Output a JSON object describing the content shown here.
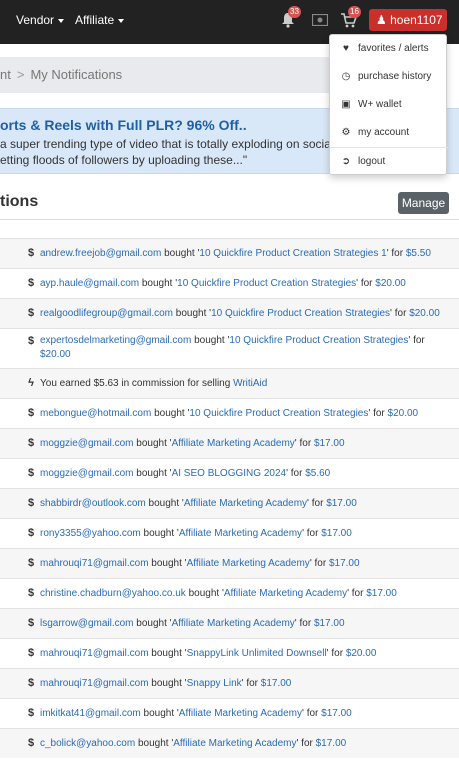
{
  "navbar": {
    "vendor_label": "Vendor",
    "affiliate_label": "Affiliate",
    "notifications_count": "33",
    "cart_count": "16",
    "username": "hoen1107"
  },
  "dropdown": {
    "items": [
      {
        "label": "favorites / alerts",
        "icon": "heart-icon"
      },
      {
        "label": "purchase history",
        "icon": "history-icon"
      },
      {
        "label": "W+ wallet",
        "icon": "wallet-icon"
      },
      {
        "label": "my account",
        "icon": "gear-icon"
      },
      {
        "label": "logout",
        "icon": "logout-icon"
      }
    ]
  },
  "breadcrumb": {
    "parent": "nt",
    "current": "My Notifications"
  },
  "promo": {
    "title": "orts & Reels with Full PLR? 96% Off..",
    "line1": "a super trending type of video that is totally exploding on socia",
    "line2": "etting floods of followers by uploading these...\""
  },
  "section": {
    "title": "tions",
    "manage_label": "Manage"
  },
  "notifications": [
    {
      "icon": "$",
      "email": "andrew.freejob@gmail.com",
      "verb": " bought '",
      "product": "10 Quickfire Product Creation Strategies 1",
      "mid": "' for ",
      "price": "$5.50",
      "tail": ""
    },
    {
      "icon": "$",
      "email": "ayp.haule@gmail.com",
      "verb": " bought '",
      "product": "10 Quickfire Product Creation Strategies",
      "mid": "' for ",
      "price": "$20.00",
      "tail": ""
    },
    {
      "icon": "$",
      "email": "realgoodlifegroup@gmail.com",
      "verb": " bought '",
      "product": "10 Quickfire Product Creation Strategies",
      "mid": "' for ",
      "price": "$20.00",
      "tail": ""
    },
    {
      "icon": "$",
      "email": "expertosdelmarketing@gmail.com",
      "verb": " bought '",
      "product": "10 Quickfire Product Creation Strategies",
      "mid": "' for ",
      "price": "$20.00",
      "tail": ""
    },
    {
      "icon": "ϟ",
      "email": "",
      "verb": "You earned $5.63 in commission for selling ",
      "product": "WritiAid",
      "mid": "",
      "price": "",
      "tail": ""
    },
    {
      "icon": "$",
      "email": "mebongue@hotmail.com",
      "verb": " bought '",
      "product": "10 Quickfire Product Creation Strategies",
      "mid": "' for ",
      "price": "$20.00",
      "tail": ""
    },
    {
      "icon": "$",
      "email": "moggzie@gmail.com",
      "verb": " bought '",
      "product": "Affiliate Marketing Academy",
      "mid": "' for ",
      "price": "$17.00",
      "tail": ""
    },
    {
      "icon": "$",
      "email": "moggzie@gmail.com",
      "verb": " bought '",
      "product": "AI SEO BLOGGING 2024",
      "mid": "' for ",
      "price": "$5.60",
      "tail": ""
    },
    {
      "icon": "$",
      "email": "shabbirdr@outlook.com",
      "verb": " bought '",
      "product": "Affiliate Marketing Academy",
      "mid": "' for ",
      "price": "$17.00",
      "tail": ""
    },
    {
      "icon": "$",
      "email": "rony3355@yahoo.com",
      "verb": " bought '",
      "product": "Affiliate Marketing Academy",
      "mid": "' for ",
      "price": "$17.00",
      "tail": ""
    },
    {
      "icon": "$",
      "email": "mahrouqi71@gmail.com",
      "verb": " bought '",
      "product": "Affiliate Marketing Academy",
      "mid": "' for ",
      "price": "$17.00",
      "tail": ""
    },
    {
      "icon": "$",
      "email": "christine.chadburn@yahoo.co.uk",
      "verb": " bought '",
      "product": "Affiliate Marketing Academy",
      "mid": "' for ",
      "price": "$17.00",
      "tail": ""
    },
    {
      "icon": "$",
      "email": "lsgarrow@gmail.com",
      "verb": " bought '",
      "product": "Affiliate Marketing Academy",
      "mid": "' for ",
      "price": "$17.00",
      "tail": ""
    },
    {
      "icon": "$",
      "email": "mahrouqi71@gmail.com",
      "verb": " bought '",
      "product": "SnappyLink Unlimited Downsell",
      "mid": "' for ",
      "price": "$20.00",
      "tail": ""
    },
    {
      "icon": "$",
      "email": "mahrouqi71@gmail.com",
      "verb": " bought '",
      "product": "Snappy Link",
      "mid": "' for ",
      "price": "$17.00",
      "tail": ""
    },
    {
      "icon": "$",
      "email": "imkitkat41@gmail.com",
      "verb": " bought '",
      "product": "Affiliate Marketing Academy",
      "mid": "' for ",
      "price": "$17.00",
      "tail": ""
    },
    {
      "icon": "$",
      "email": "c_bolick@yahoo.com",
      "verb": " bought '",
      "product": "Affiliate Marketing Academy",
      "mid": "' for ",
      "price": "$17.00",
      "tail": ""
    }
  ]
}
